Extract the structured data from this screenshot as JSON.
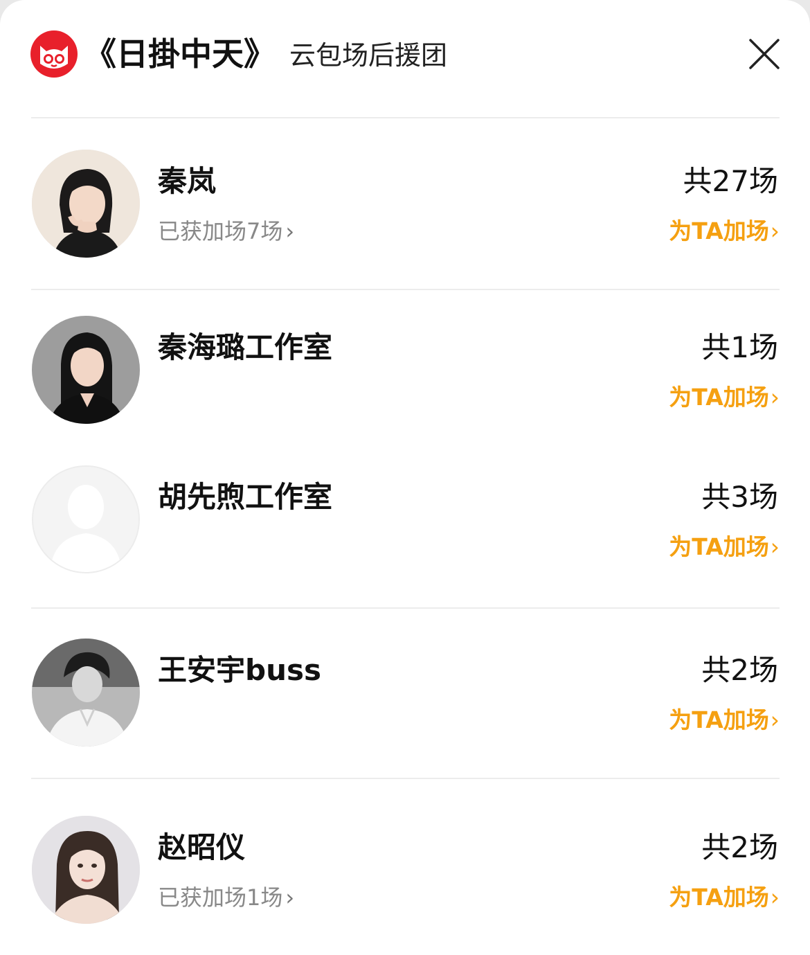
{
  "header": {
    "title": "《日掛中天》",
    "subtitle": "云包场后援团",
    "logo_icon": "maoyan-cat-logo-icon",
    "close_icon": "close-icon"
  },
  "colors": {
    "accent": "#f5a011",
    "logo_red": "#e8202b",
    "text_primary": "#111111",
    "text_secondary": "#888888",
    "divider": "#ececec"
  },
  "supporters": [
    {
      "name": "秦岚",
      "total": "共27场",
      "obtained": "已获加场7场",
      "add_label": "为TA加场",
      "avatar_icon": "avatar-photo-woman-icon"
    },
    {
      "name": "秦海璐工作室",
      "total": "共1场",
      "obtained": "",
      "add_label": "为TA加场",
      "avatar_icon": "avatar-photo-woman-icon"
    },
    {
      "name": "胡先煦工作室",
      "total": "共3场",
      "obtained": "",
      "add_label": "为TA加场",
      "avatar_icon": "default-avatar-silhouette-icon"
    },
    {
      "name": "王安宇buss",
      "total": "共2场",
      "obtained": "",
      "add_label": "为TA加场",
      "avatar_icon": "avatar-photo-man-icon"
    },
    {
      "name": "赵昭仪",
      "total": "共2场",
      "obtained": "已获加场1场",
      "add_label": "为TA加场",
      "avatar_icon": "avatar-photo-woman-icon"
    }
  ],
  "chevron": "›"
}
